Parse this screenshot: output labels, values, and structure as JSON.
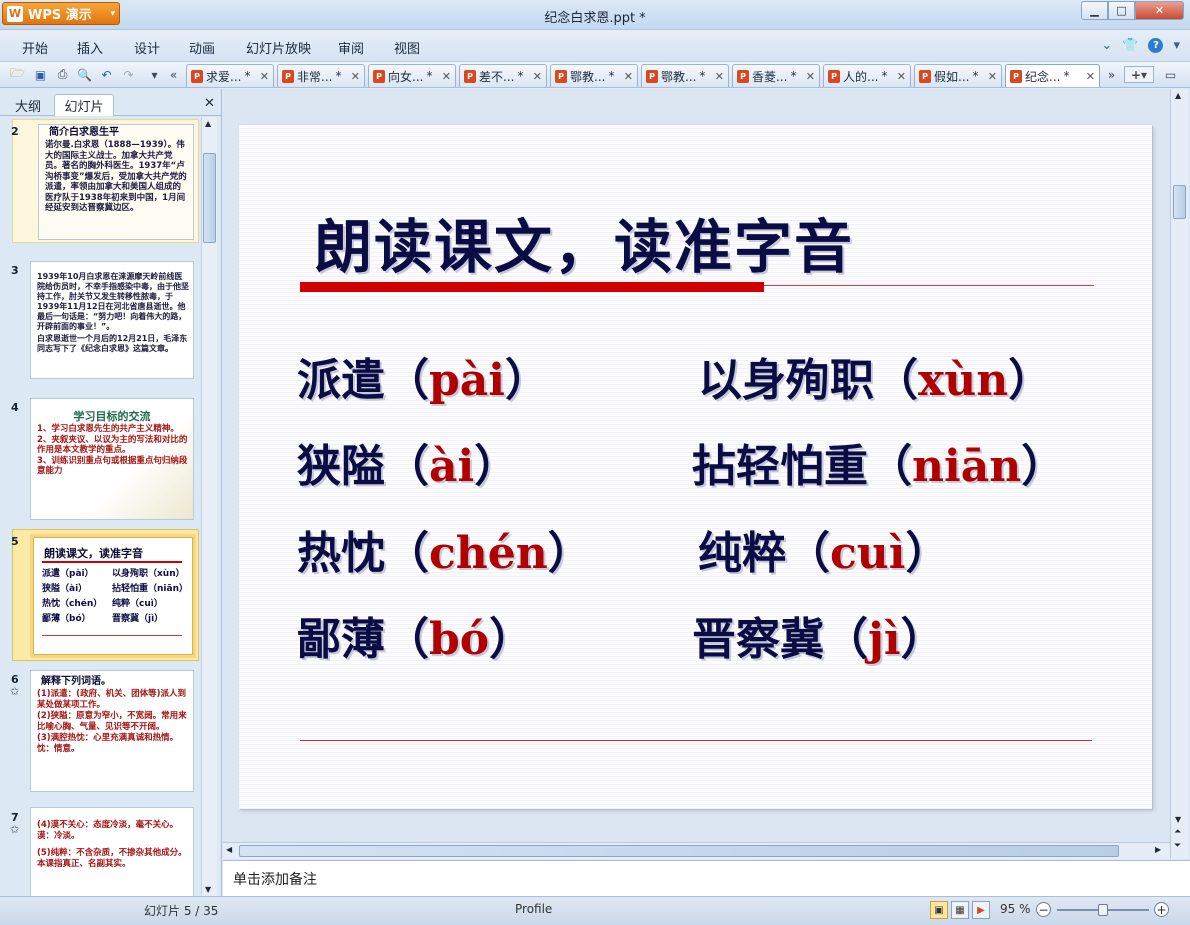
{
  "app": {
    "menu_label": "WPS 演示",
    "title": "纪念白求恩.ppt *"
  },
  "menus": [
    "开始",
    "插入",
    "设计",
    "动画",
    "幻灯片放映",
    "审阅",
    "视图"
  ],
  "doc_tabs": [
    "求爱...",
    "非常...",
    "向女...",
    "差不...",
    "鄂教...",
    "鄂教...",
    "香菱...",
    "人的...",
    "假如...",
    "纪念..."
  ],
  "active_tab_index": 9,
  "left_panel": {
    "tab_outline": "大纲",
    "tab_slides": "幻灯片"
  },
  "thumbnails": [
    {
      "number": "2",
      "title": "简介白求恩生平",
      "lines": [
        "诺尔曼.白求恩（1888—1939）。伟大的国际主义战士。加拿大共产党员。著名的胸外科医生。1937年“卢沟桥事变”爆发后，受加拿大共产党的派遣，率领由加拿大和美国人组成的医疗队于1938年初来到中国，1月间经延安到达晋察冀边区。"
      ]
    },
    {
      "number": "3",
      "lines": [
        "1939年10月白求恩在涞源摩天岭前线医院给伤员时，不幸手指感染中毒，由于他坚持工作，肘关节又发生转移性脓毒，于1939年11月12日在河北省唐县逝世。他最后一句话是：“努力吧！向着伟大的路，开辟前面的事业！”。",
        "白求恩逝世一个月后的12月21日，毛泽东同志写下了《纪念白求恩》这篇文章。"
      ]
    },
    {
      "number": "4",
      "title": "学习目标的交流",
      "lines": [
        "1、学习白求恩先生的共产主义精神。",
        "2、夹叙夹议、以议为主的写法和对比的作用是本文教学的重点。",
        "3、训练识别重点句或根据重点句归纳段意能力"
      ]
    },
    {
      "number": "5",
      "title": "朗读课文，读准字音",
      "pairs": [
        [
          "派遣（pài）",
          "以身殉职（xùn）"
        ],
        [
          "狭隘（ài）",
          "拈轻怕重（niān）"
        ],
        [
          "热忱（chén）",
          "纯粹（cuì）"
        ],
        [
          "鄙薄（bó）",
          "晋察冀（jì）"
        ]
      ]
    },
    {
      "number": "6",
      "title": "解释下列词语。",
      "lines": [
        "(1)派遣：(政府、机关、团体等)派人到某处做某项工作。",
        "(2)狭隘：原意为窄小，不宽阔。常用来比喻心胸、气量、见识等不开阔。",
        "(3)满腔热忱：心里充满真诚和热情。忱：情意。"
      ]
    },
    {
      "number": "7",
      "lines": [
        "(4)漠不关心：态度冷淡，毫不关心。漠：冷淡。",
        "(5)纯粹：不含杂质，不掺杂其他成分。本课指真正、名副其实。"
      ]
    }
  ],
  "slide": {
    "title": "朗读课文，读准字音",
    "entries": [
      {
        "word": "派遣",
        "pinyin": "pài"
      },
      {
        "word": "以身殉职",
        "pinyin": "xùn"
      },
      {
        "word": "狭隘",
        "pinyin": "ài"
      },
      {
        "word": "拈轻怕重",
        "pinyin": "niān"
      },
      {
        "word": "热忱",
        "pinyin": "chén"
      },
      {
        "word": "纯粹",
        "pinyin": "cuì"
      },
      {
        "word": "鄙薄",
        "pinyin": "bó"
      },
      {
        "word": "晋察冀",
        "pinyin": "jì"
      }
    ],
    "paren_open": "（",
    "paren_close": "）"
  },
  "notes_placeholder": "单击添加备注",
  "status": {
    "slide_counter": "幻灯片 5 / 35",
    "profile": "Profile",
    "zoom": "95 %"
  },
  "zoom_fraction": 0.5,
  "colors": {
    "title_navy": "#0c0c45",
    "pinyin_red": "#b00000",
    "accent_red": "#d00000",
    "app_orange": "#e2740f"
  }
}
